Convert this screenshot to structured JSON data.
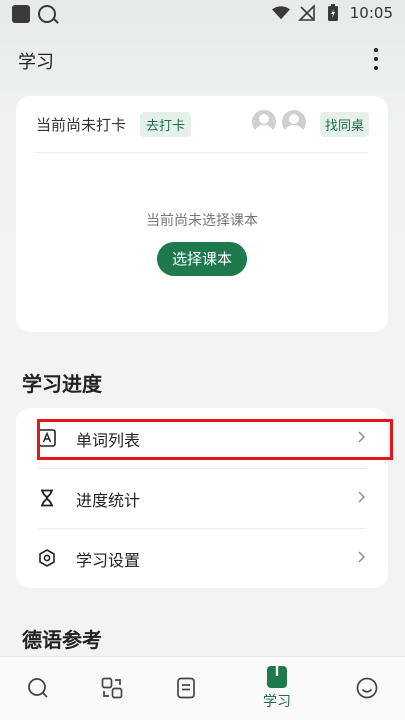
{
  "status_bar": {
    "time": "10:05"
  },
  "app_bar": {
    "title": "学习"
  },
  "checkin": {
    "status_text": "当前尚未打卡",
    "checkin_label": "去打卡",
    "deskmate_label": "找同桌",
    "empty_text": "当前尚未选择课本",
    "choose_book_label": "选择课本"
  },
  "progress_section": {
    "title": "学习进度",
    "items": [
      {
        "label": "单词列表",
        "icon": "vocabulary-icon"
      },
      {
        "label": "进度统计",
        "icon": "hourglass-icon"
      },
      {
        "label": "学习设置",
        "icon": "settings-hexagon-icon"
      }
    ]
  },
  "reference_section": {
    "title": "德语参考"
  },
  "bottom_nav": {
    "items": [
      {
        "icon": "search-icon",
        "label": ""
      },
      {
        "icon": "flashcards-icon",
        "label": ""
      },
      {
        "icon": "notes-icon",
        "label": ""
      },
      {
        "icon": "book-icon",
        "label": "学习"
      },
      {
        "icon": "smiley-icon",
        "label": ""
      }
    ]
  },
  "colors": {
    "accent": "#1e7a4c",
    "highlight": "#e0161b"
  }
}
